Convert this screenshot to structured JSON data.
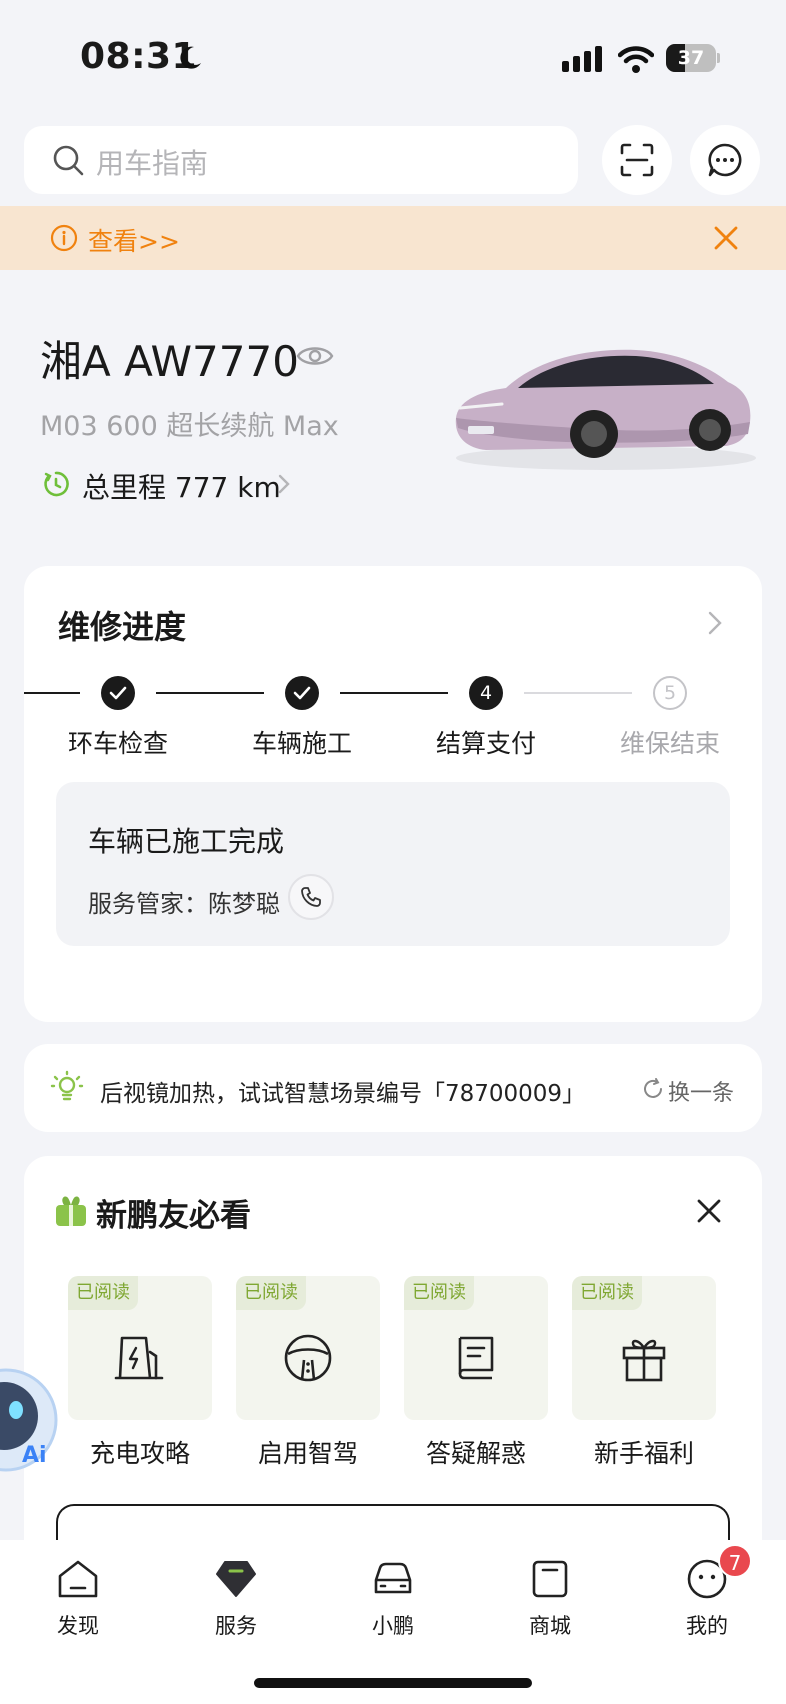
{
  "status_bar": {
    "time": "08:31",
    "battery": "37",
    "battery_level": 0.37
  },
  "search": {
    "placeholder": "用车指南"
  },
  "notice": {
    "text": "查看>>"
  },
  "vehicle": {
    "plate": "湘A AW7770",
    "model": "M03 600 超长续航 Max",
    "mileage": "总里程 777 km"
  },
  "repair": {
    "title": "维修进度",
    "steps": [
      {
        "label": "环车检查",
        "state": "done",
        "number": ""
      },
      {
        "label": "车辆施工",
        "state": "done",
        "number": ""
      },
      {
        "label": "结算支付",
        "state": "current",
        "number": "4"
      },
      {
        "label": "维保结束",
        "state": "pending",
        "number": "5"
      }
    ],
    "status_text": "车辆已施工完成",
    "advisor_label": "服务管家：陈梦聪"
  },
  "tip": {
    "text": "后视镜加热，试试智慧场景编号「78700009」",
    "refresh_label": "换一条"
  },
  "newbie": {
    "title": "新鹏友必看",
    "tiles": [
      {
        "label": "充电攻略",
        "badge": "已阅读",
        "icon": "charging-station-icon"
      },
      {
        "label": "启用智驾",
        "badge": "已阅读",
        "icon": "steering-wheel-icon"
      },
      {
        "label": "答疑解惑",
        "badge": "已阅读",
        "icon": "book-icon"
      },
      {
        "label": "新手福利",
        "badge": "已阅读",
        "icon": "gift-icon"
      }
    ]
  },
  "ai_bubble": {
    "label": "Ai"
  },
  "tabbar": {
    "tabs": [
      {
        "label": "发现",
        "icon": "house-icon"
      },
      {
        "label": "服务",
        "icon": "service-icon"
      },
      {
        "label": "小鹏",
        "icon": "car-icon"
      },
      {
        "label": "商城",
        "icon": "shopping-bag-icon"
      },
      {
        "label": "我的",
        "icon": "profile-icon"
      }
    ],
    "active": "服务",
    "badge": "7"
  },
  "colors": {
    "accent_orange": "#f0820f",
    "notice_bg": "#f8e5d0",
    "badge_green": "#7fa732",
    "brand_green": "#8bc34a",
    "badge_red": "#e9484e"
  }
}
